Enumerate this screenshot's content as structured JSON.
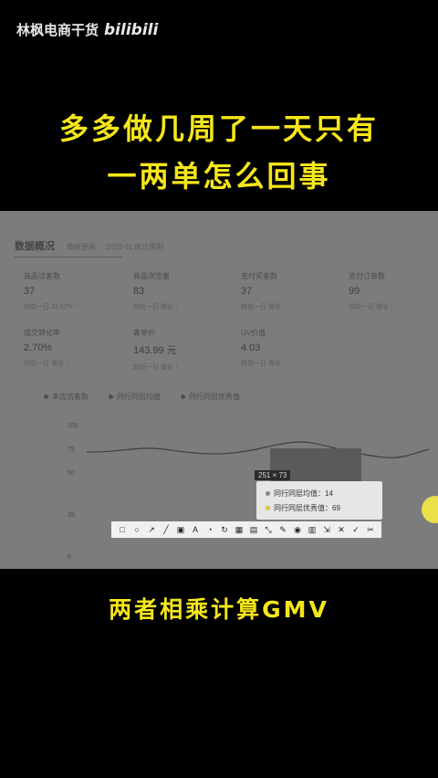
{
  "watermark": {
    "channel": "林枫电商干货",
    "logo": "bilibili"
  },
  "headline": {
    "line1": "多多做几周了一天只有",
    "line2": "一两单怎么回事"
  },
  "caption": "两者相乘计算GMV",
  "panel": {
    "title": "数据概况",
    "title_sub1": "数据更新",
    "title_sub2": "2023-11 统计周期",
    "metrics": [
      {
        "label": "商品访客数",
        "value": "37",
        "sub": "较前一日 22.92% ↑"
      },
      {
        "label": "商品浏览量",
        "value": "83",
        "sub": "较前一日 增长 ↑"
      },
      {
        "label": "支付买家数",
        "value": "37",
        "sub": "较前一日 增长 ↑"
      },
      {
        "label": "支付订单数",
        "value": "99",
        "sub": "较前一日 增长 ↑"
      },
      {
        "label": "成交转化率",
        "value": "2.70%",
        "sub": "较前一日 增长 ↑"
      },
      {
        "label": "客单价",
        "value": "143.99 元",
        "sub": "较前一日 增长 ↑"
      },
      {
        "label": "UV价值",
        "value": "4.03",
        "sub": "较前一日 增长 ↑"
      }
    ],
    "legend": [
      "本店访客数",
      "同行同层均值",
      "同行同层优秀值"
    ],
    "y_ticks": [
      "100",
      "75",
      "50",
      "25",
      "0"
    ],
    "size_readout": "251 × 73",
    "tooltip": [
      {
        "label": "同行同层均值：14",
        "color": "#8a8a8a"
      },
      {
        "label": "同行同层优秀值：69",
        "color": "#d9c43a"
      }
    ],
    "toolbar_icons": [
      "□",
      "○",
      "↗",
      "╱",
      "▣",
      "A",
      "◔",
      "↻",
      "▦",
      "▤",
      "⤡",
      "✎",
      "◉",
      "▥",
      "⇲",
      "✕",
      "✓",
      "✂"
    ]
  }
}
